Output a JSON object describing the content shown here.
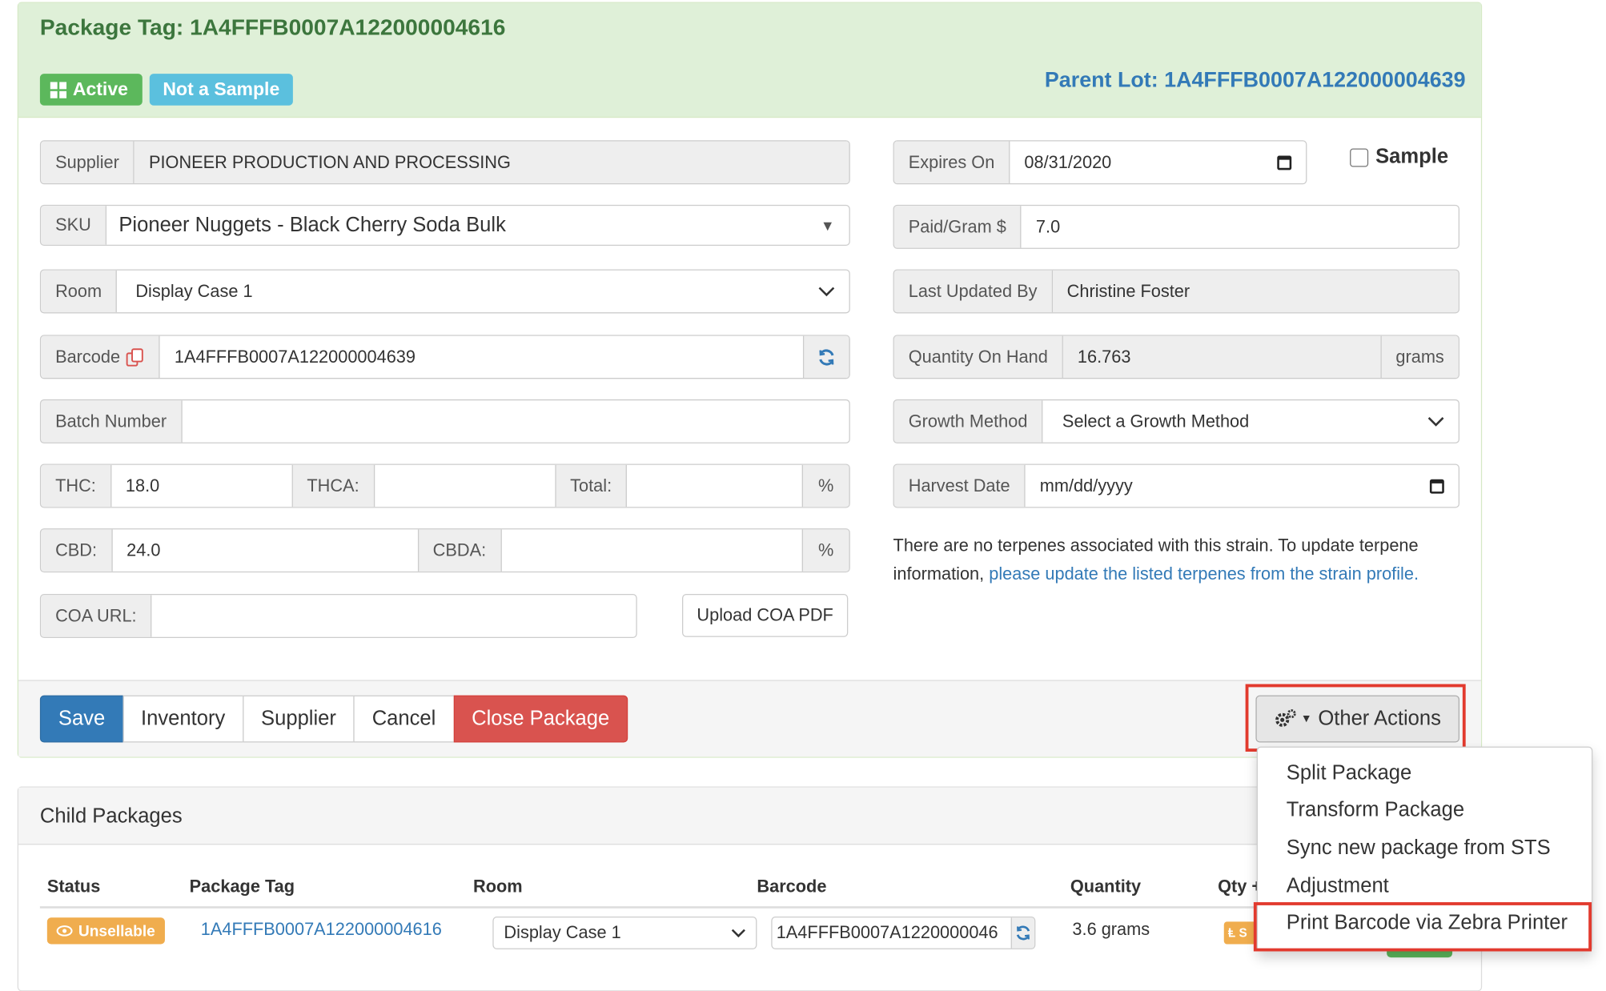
{
  "header": {
    "title": "Package Tag: 1A4FFFB0007A122000004616",
    "status_badge": "Active",
    "sample_badge": "Not a Sample",
    "parent_lot": "Parent Lot: 1A4FFFB0007A122000004639"
  },
  "form": {
    "supplier": {
      "label": "Supplier",
      "value": "PIONEER PRODUCTION AND PROCESSING"
    },
    "sku": {
      "label": "SKU",
      "value": "Pioneer Nuggets - Black Cherry Soda Bulk"
    },
    "room": {
      "label": "Room",
      "value": "Display Case 1"
    },
    "barcode": {
      "label": "Barcode",
      "value": "1A4FFFB0007A122000004639"
    },
    "batch_number": {
      "label": "Batch Number",
      "value": ""
    },
    "thc": {
      "label": "THC:",
      "value": "18.0"
    },
    "thca": {
      "label": "THCA:",
      "value": ""
    },
    "total": {
      "label": "Total:",
      "value": "",
      "unit": "%"
    },
    "cbd": {
      "label": "CBD:",
      "value": "24.0"
    },
    "cbda": {
      "label": "CBDA:",
      "value": "",
      "unit": "%"
    },
    "coa_url": {
      "label": "COA URL:",
      "value": ""
    },
    "upload_coa": "Upload COA PDF",
    "expires_on": {
      "label": "Expires On",
      "value": "08/31/2020"
    },
    "sample": {
      "label": "Sample",
      "checked": false
    },
    "paid_gram": {
      "label": "Paid/Gram $",
      "value": "7.0"
    },
    "last_updated_by": {
      "label": "Last Updated By",
      "value": "Christine Foster"
    },
    "quantity_on_hand": {
      "label": "Quantity On Hand",
      "value": "16.763",
      "unit": "grams"
    },
    "growth_method": {
      "label": "Growth Method",
      "value": "Select a Growth Method"
    },
    "harvest_date": {
      "label": "Harvest Date",
      "value": "mm/dd/yyyy"
    },
    "terpenes_text": "There are no terpenes associated with this strain. To update terpene information,",
    "terpenes_link": "please update the listed terpenes from the strain profile."
  },
  "actions": {
    "save": "Save",
    "inventory": "Inventory",
    "supplier": "Supplier",
    "cancel": "Cancel",
    "close_package": "Close Package",
    "other_actions": "Other Actions"
  },
  "other_actions_menu": [
    "Split Package",
    "Transform Package",
    "Sync new package from STS",
    "Adjustment",
    "Print Barcode via Zebra Printer"
  ],
  "child_packages": {
    "title": "Child Packages",
    "columns": [
      "Status",
      "Package Tag",
      "Room",
      "Barcode",
      "Quantity",
      "Qty +"
    ],
    "rows": [
      {
        "status": "Unsellable",
        "package_tag": "1A4FFFB0007A122000004616",
        "room": "Display Case 1",
        "barcode": "1A4FFFB0007A1220000046",
        "quantity": "3.6 grams",
        "qty_badge": "Ⱡ S"
      }
    ]
  },
  "colors": {
    "success": "#5cb85c",
    "info": "#5bc0de",
    "primary": "#337ab7",
    "danger": "#d9534f",
    "warning": "#f0ad4e",
    "highlight": "#e23a2e"
  }
}
